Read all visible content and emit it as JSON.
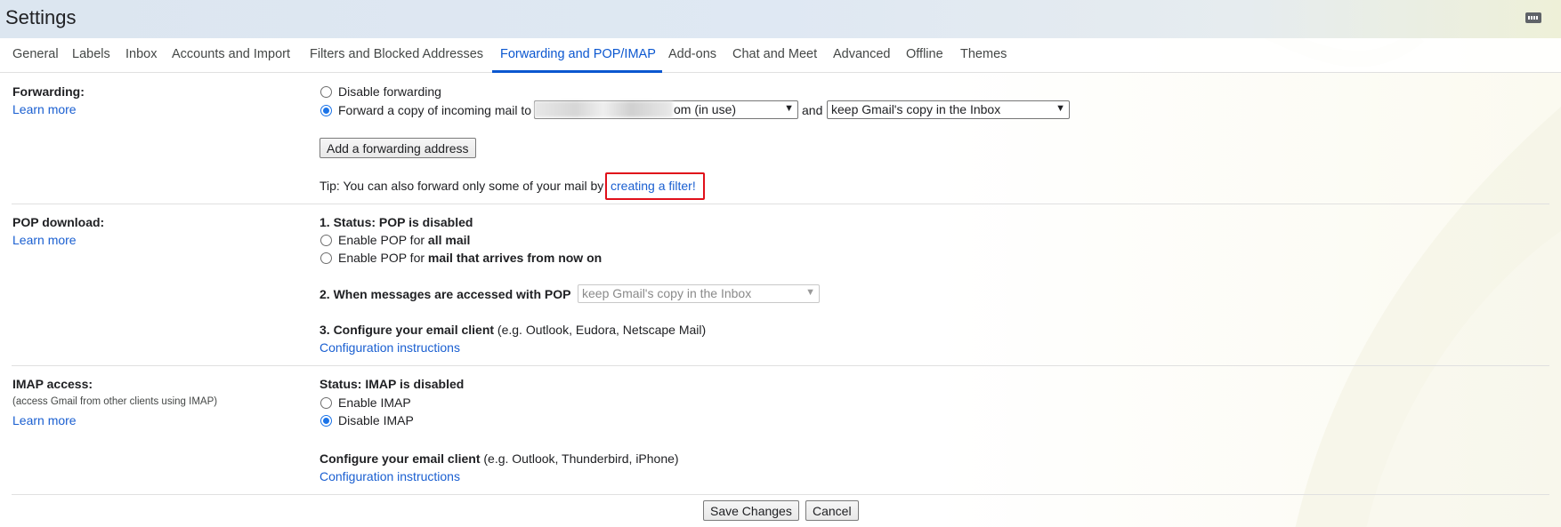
{
  "header": {
    "title": "Settings",
    "keyboard_icon": "keyboard-icon"
  },
  "tabs": [
    {
      "label": "General"
    },
    {
      "label": "Labels"
    },
    {
      "label": "Inbox"
    },
    {
      "label": "Accounts and Import"
    },
    {
      "label": "Filters and Blocked Addresses"
    },
    {
      "label": "Forwarding and POP/IMAP",
      "active": true
    },
    {
      "label": "Add-ons"
    },
    {
      "label": "Chat and Meet"
    },
    {
      "label": "Advanced"
    },
    {
      "label": "Offline"
    },
    {
      "label": "Themes"
    }
  ],
  "forwarding": {
    "label": "Forwarding:",
    "learn_more": "Learn more",
    "disable_option": "Disable forwarding",
    "forward_option": "Forward a copy of incoming mail to",
    "address_select_visible": "om (in use)",
    "and": "and",
    "action_select": "keep Gmail's copy in the Inbox",
    "add_button": "Add a forwarding address",
    "tip_prefix": "Tip: You can also forward only some of your mail by",
    "tip_link": "creating a filter!"
  },
  "pop": {
    "label": "POP download:",
    "learn_more": "Learn more",
    "status": "1. Status: POP is disabled",
    "enable_all_prefix": "Enable POP for ",
    "enable_all_bold": "all mail",
    "enable_now_prefix": "Enable POP for ",
    "enable_now_bold": "mail that arrives from now on",
    "accessed_label": "2. When messages are accessed with POP",
    "accessed_select": "keep Gmail's copy in the Inbox",
    "configure_bold": "3. Configure your email client",
    "configure_rest": " (e.g. Outlook, Eudora, Netscape Mail)",
    "config_link": "Configuration instructions"
  },
  "imap": {
    "label": "IMAP access:",
    "sublabel": "(access Gmail from other clients using IMAP)",
    "learn_more": "Learn more",
    "status": "Status: IMAP is disabled",
    "enable_option": "Enable IMAP",
    "disable_option": "Disable IMAP",
    "configure_bold": "Configure your email client",
    "configure_rest": " (e.g. Outlook, Thunderbird, iPhone)",
    "config_link": "Configuration instructions"
  },
  "footer": {
    "save": "Save Changes",
    "cancel": "Cancel"
  },
  "colors": {
    "accent": "#0b57d0",
    "link": "#1a5fd1",
    "highlight": "#e0101a"
  }
}
